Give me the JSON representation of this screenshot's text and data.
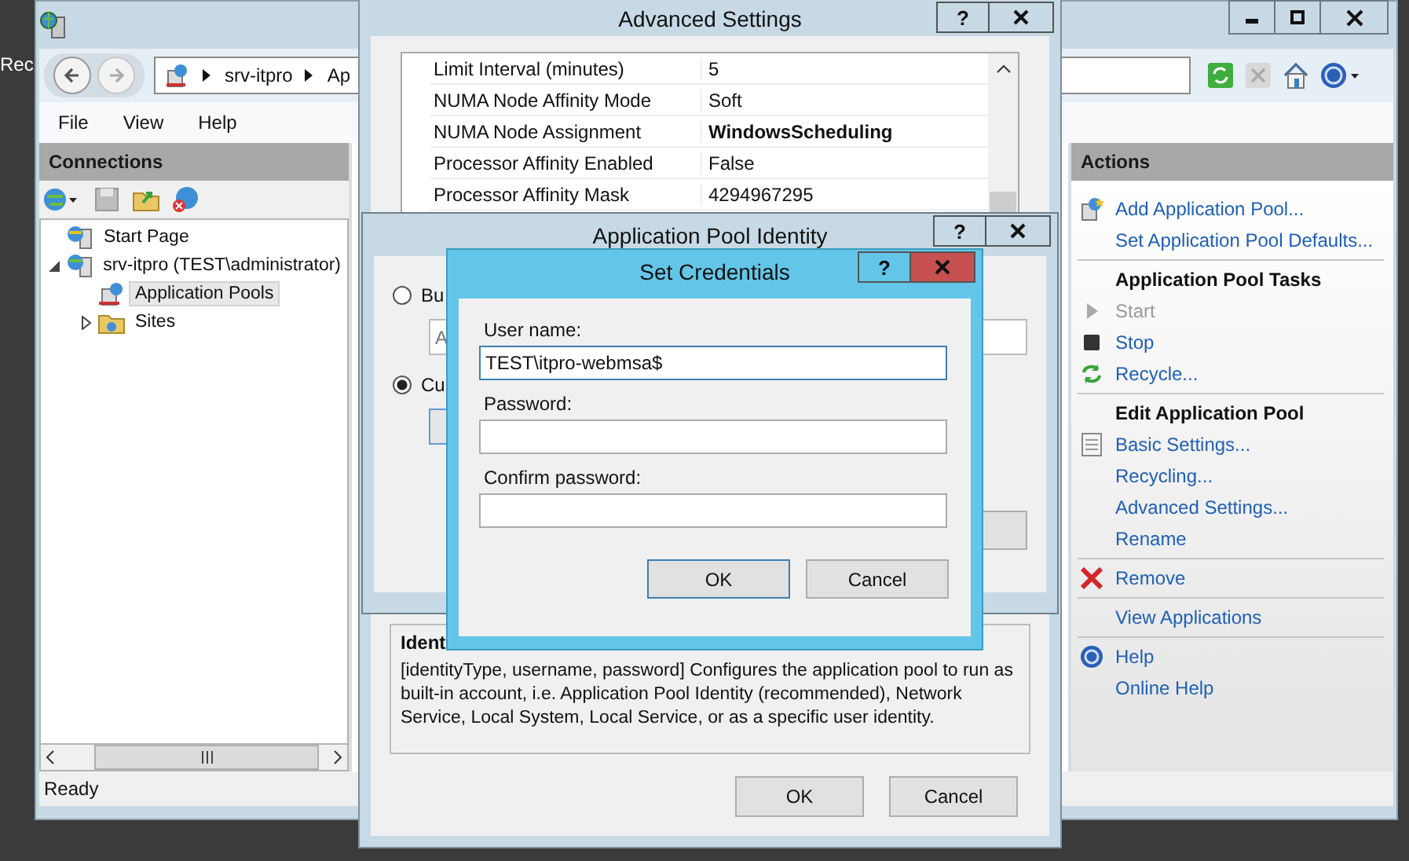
{
  "desktop": {
    "icon_label": "Rec"
  },
  "main_window": {
    "address_bar": {
      "segments": [
        "srv-itpro",
        "Ap"
      ]
    },
    "menu": [
      "File",
      "View",
      "Help"
    ],
    "connections": {
      "title": "Connections",
      "tree": [
        {
          "label": "Start Page",
          "kind": "page",
          "selected": false
        },
        {
          "label": "srv-itpro (TEST\\administrator)",
          "kind": "server",
          "selected": false,
          "expanded": true,
          "children": [
            {
              "label": "Application Pools",
              "kind": "pools",
              "selected": true
            },
            {
              "label": "Sites",
              "kind": "sites",
              "selected": false,
              "expanded": false
            }
          ]
        }
      ]
    },
    "actions": {
      "title": "Actions",
      "groups": [
        [
          {
            "label": "Add Application Pool...",
            "kind": "add",
            "disabled": false
          },
          {
            "label": "Set Application Pool Defaults...",
            "kind": "plain",
            "disabled": false
          }
        ],
        [
          {
            "label": "Application Pool Tasks",
            "kind": "heading"
          },
          {
            "label": "Start",
            "kind": "start",
            "disabled": true
          },
          {
            "label": "Stop",
            "kind": "stop",
            "disabled": false
          },
          {
            "label": "Recycle...",
            "kind": "recycle",
            "disabled": false
          }
        ],
        [
          {
            "label": "Edit Application Pool",
            "kind": "heading"
          },
          {
            "label": "Basic Settings...",
            "kind": "settings",
            "disabled": false
          },
          {
            "label": "Recycling...",
            "kind": "plain",
            "disabled": false
          },
          {
            "label": "Advanced Settings...",
            "kind": "plain",
            "disabled": false
          },
          {
            "label": "Rename",
            "kind": "plain",
            "disabled": false
          }
        ],
        [
          {
            "label": "Remove",
            "kind": "remove",
            "disabled": false
          }
        ],
        [
          {
            "label": "View Applications",
            "kind": "plain",
            "disabled": false
          }
        ],
        [
          {
            "label": "Help",
            "kind": "help",
            "disabled": false
          },
          {
            "label": "Online Help",
            "kind": "plain",
            "disabled": false
          }
        ]
      ]
    },
    "status_bar": "Ready"
  },
  "advanced_settings": {
    "title": "Advanced Settings",
    "help_glyph": "?",
    "properties": [
      {
        "name": "Limit Interval (minutes)",
        "value": "5",
        "bold": false
      },
      {
        "name": "NUMA Node Affinity Mode",
        "value": "Soft",
        "bold": false
      },
      {
        "name": "NUMA Node Assignment",
        "value": "WindowsScheduling",
        "bold": true
      },
      {
        "name": "Processor Affinity Enabled",
        "value": "False",
        "bold": false
      },
      {
        "name": "Processor Affinity Mask",
        "value": "4294967295",
        "bold": false
      }
    ],
    "description": {
      "title": "Ident",
      "text": "[identityType, username, password] Configures the application pool to run as built-in account, i.e. Application Pool Identity (recommended), Network Service, Local System, Local Service, or as a specific user identity."
    },
    "buttons": [
      {
        "label": "OK"
      },
      {
        "label": "Cancel"
      }
    ]
  },
  "identity_dialog": {
    "title": "Application Pool Identity",
    "help_glyph": "?",
    "options": [
      {
        "label": "Bu",
        "selected": false,
        "field_value": "A"
      },
      {
        "label": "Cu",
        "selected": true
      }
    ]
  },
  "credentials_dialog": {
    "title": "Set Credentials",
    "help_glyph": "?",
    "fields": [
      {
        "label": "User name:",
        "value": "TEST\\itpro-webmsa$",
        "focused": true
      },
      {
        "label": "Password:",
        "focused": false
      },
      {
        "label": "Confirm password:",
        "focused": false
      }
    ],
    "buttons": [
      {
        "label": "OK",
        "default": true
      },
      {
        "label": "Cancel",
        "default": false
      }
    ]
  }
}
